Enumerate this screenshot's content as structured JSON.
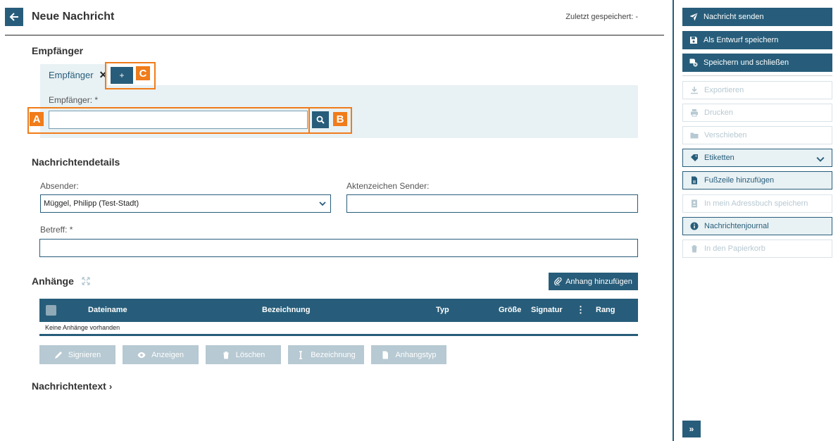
{
  "header": {
    "title": "Neue Nachricht",
    "saved_status": "Zuletzt gespeichert: -"
  },
  "recipients": {
    "section_title": "Empfänger",
    "tab_label": "Empfänger",
    "add_label": "+",
    "field_label": "Empfänger: *",
    "input_value": ""
  },
  "details": {
    "section_title": "Nachrichtendetails",
    "sender_label": "Absender:",
    "sender_value": "Müggel, Philipp (Test-Stadt)",
    "reference_label": "Aktenzeichen Sender:",
    "reference_value": "",
    "subject_label": "Betreff: *",
    "subject_value": ""
  },
  "attachments": {
    "section_title": "Anhänge",
    "add_button": "Anhang hinzufügen",
    "columns": [
      "Dateiname",
      "Bezeichnung",
      "Typ",
      "Größe",
      "Signatur",
      "Rang"
    ],
    "empty_text": "Keine Anhänge vorhanden",
    "actions": [
      "Signieren",
      "Anzeigen",
      "Löschen",
      "Bezeichnung",
      "Anhangstyp"
    ]
  },
  "message_text": {
    "label": "Nachrichtentext",
    "arrow": "›"
  },
  "sidebar": {
    "send": "Nachricht senden",
    "draft": "Als Entwurf speichern",
    "save_close": "Speichern und schließen",
    "export": "Exportieren",
    "print": "Drucken",
    "move": "Verschieben",
    "labels": "Etiketten",
    "footer": "Fußzeile hinzufügen",
    "addressbook": "In mein Adressbuch speichern",
    "journal": "Nachrichtenjournal",
    "trash": "In den Papierkorb",
    "collapse": "»"
  },
  "annotations": {
    "a": "A",
    "b": "B",
    "c": "C",
    "color": "#f07c1a"
  },
  "colors": {
    "primary": "#275d7a",
    "panel": "#e8f1f4",
    "disabled": "#b7c9d2"
  }
}
